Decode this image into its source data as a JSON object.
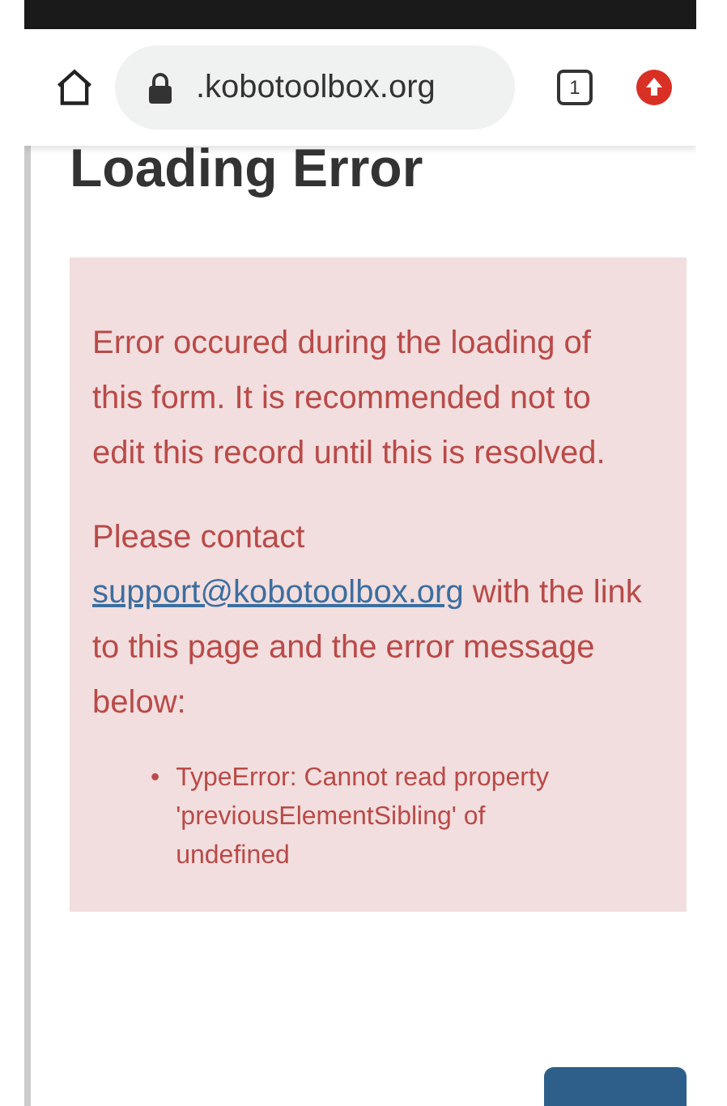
{
  "browser": {
    "url": ".kobotoolbox.org",
    "tab_count": "1"
  },
  "page": {
    "title": "Loading Error",
    "alert": {
      "message": "Error occured during the loading of this form. It is recommended not to edit this record until this is resolved.",
      "contact_before": "Please contact ",
      "contact_link": "support@kobotoolbox.org",
      "contact_after": " with the link to this page and the error message below:",
      "errors": [
        {
          "bullet": "•",
          "text": "TypeError: Cannot read property 'previousElementSibling' of undefined"
        }
      ]
    },
    "button": {
      "kind": "primary"
    }
  }
}
